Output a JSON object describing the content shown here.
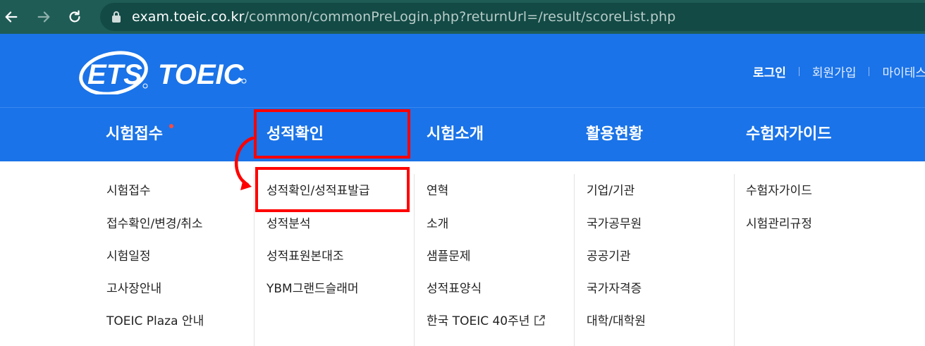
{
  "browser": {
    "url_host": "exam.toeic.co.kr",
    "url_path": "/common/commonPreLogin.php?returnUrl=/result/scoreList.php"
  },
  "header": {
    "logo_text": "ETS TOEIC",
    "login": "로그인",
    "signup": "회원가입",
    "mypage": "마이테스트"
  },
  "nav": {
    "items": [
      "시험접수",
      "성적확인",
      "시험소개",
      "활용현황",
      "수험자가이드"
    ]
  },
  "dropdown": {
    "col1": [
      "시험접수",
      "접수확인/변경/취소",
      "시험일정",
      "고사장안내",
      "TOEIC Plaza 안내"
    ],
    "col2": [
      "성적확인/성적표발급",
      "성적분석",
      "성적표원본대조",
      "YBM그랜드슬래머"
    ],
    "col3": [
      "연혁",
      "소개",
      "샘플문제",
      "성적표양식",
      "한국 TOEIC 40주년"
    ],
    "col4": [
      "기업/기관",
      "국가공무원",
      "공공기관",
      "국가자격증",
      "대학/대학원"
    ],
    "col5": [
      "수험자가이드",
      "시험관리규정"
    ]
  },
  "colors": {
    "brand_blue": "#1a73e8",
    "browser_green": "#1f5c56",
    "annotation_red": "#ff0000"
  }
}
